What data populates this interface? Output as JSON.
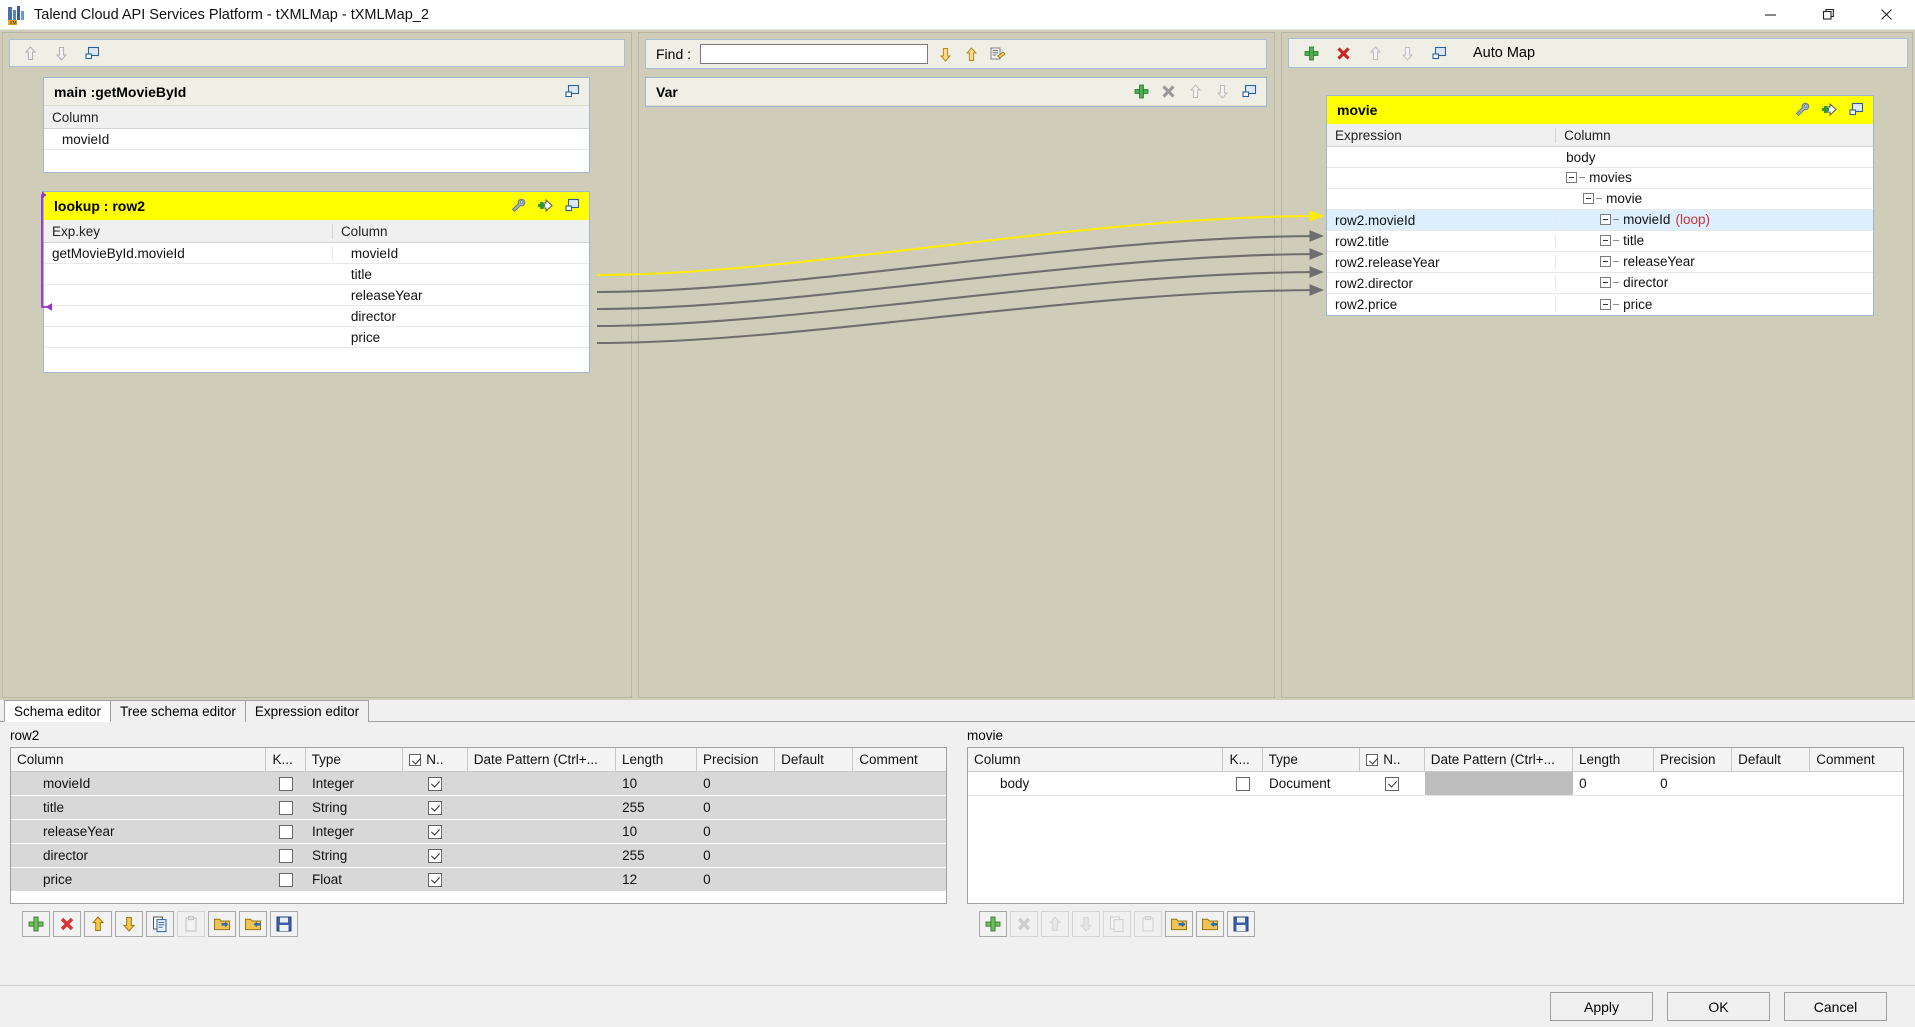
{
  "window": {
    "title": "Talend Cloud API Services Platform - tXMLMap - tXMLMap_2",
    "app_icon": "talend-icon",
    "minimize": "—",
    "maximize": "❐",
    "close": "✕"
  },
  "left_panel": {
    "toolbar_icons": [
      "arrow-up-icon",
      "arrow-down-icon",
      "minimize-table-icon"
    ],
    "main_table": {
      "title": "main :getMovieById",
      "header_icon": "minimize-table-icon",
      "columns": [
        "Column"
      ],
      "rows": [
        {
          "column": "movieId"
        },
        {
          "column": ""
        }
      ]
    },
    "lookup_table": {
      "title": "lookup : row2",
      "header_icons": [
        "wrench-icon",
        "add-filter-icon",
        "minimize-table-icon"
      ],
      "columns": [
        "Exp.key",
        "Column"
      ],
      "rows": [
        {
          "expkey": "getMovieById.movieId",
          "column": "movieId"
        },
        {
          "expkey": "",
          "column": "title"
        },
        {
          "expkey": "",
          "column": "releaseYear"
        },
        {
          "expkey": "",
          "column": "director"
        },
        {
          "expkey": "",
          "column": "price"
        }
      ]
    }
  },
  "middle_panel": {
    "find": {
      "label": "Find :",
      "value": "",
      "placeholder": ""
    },
    "find_icons": [
      "arrow-down-icon",
      "arrow-up-icon",
      "find-options-icon"
    ],
    "var_table": {
      "title": "Var",
      "header_icons": [
        "add-icon",
        "delete-icon",
        "arrow-up-icon",
        "arrow-down-icon",
        "minimize-table-icon"
      ],
      "rows": []
    }
  },
  "right_panel": {
    "toolbar_icons": [
      "add-icon",
      "delete-icon",
      "arrow-up-icon",
      "arrow-down-icon",
      "minimize-table-icon"
    ],
    "auto_map_label": "Auto Map",
    "output_table": {
      "title": "movie",
      "header_icons": [
        "wrench-icon",
        "add-filter-icon",
        "minimize-table-icon"
      ],
      "columns": [
        "Expression",
        "Column"
      ],
      "rows": [
        {
          "expression": "",
          "column": "body",
          "depth": 0,
          "expandable": false,
          "selected": false,
          "loop": ""
        },
        {
          "expression": "",
          "column": "movies",
          "depth": 1,
          "expandable": true,
          "selected": false,
          "loop": ""
        },
        {
          "expression": "",
          "column": "movie",
          "depth": 2,
          "expandable": true,
          "selected": false,
          "loop": ""
        },
        {
          "expression": "row2.movieId",
          "column": "movieId",
          "depth": 3,
          "expandable": true,
          "selected": true,
          "loop": "(loop)"
        },
        {
          "expression": "row2.title",
          "column": "title",
          "depth": 3,
          "expandable": true,
          "selected": false,
          "loop": ""
        },
        {
          "expression": "row2.releaseYear",
          "column": "releaseYear",
          "depth": 3,
          "expandable": true,
          "selected": false,
          "loop": ""
        },
        {
          "expression": "row2.director",
          "column": "director",
          "depth": 3,
          "expandable": true,
          "selected": false,
          "loop": ""
        },
        {
          "expression": "row2.price",
          "column": "price",
          "depth": 3,
          "expandable": true,
          "selected": false,
          "loop": ""
        }
      ]
    }
  },
  "bottom": {
    "tabs": [
      {
        "label": "Schema editor",
        "active": true
      },
      {
        "label": "Tree schema editor",
        "active": false
      },
      {
        "label": "Expression editor",
        "active": false
      }
    ],
    "left_editor": {
      "title": "row2",
      "headers": [
        "Column",
        "K...",
        "Type",
        "N..",
        "Date Pattern (Ctrl+...",
        "Length",
        "Precision",
        "Default",
        "Comment"
      ],
      "nullable_header_checked": true,
      "rows": [
        {
          "column": "movieId",
          "key": false,
          "type": "Integer",
          "nullable": true,
          "date_pattern": "",
          "length": "10",
          "precision": "0",
          "default": "",
          "comment": ""
        },
        {
          "column": "title",
          "key": false,
          "type": "String",
          "nullable": true,
          "date_pattern": "",
          "length": "255",
          "precision": "0",
          "default": "",
          "comment": ""
        },
        {
          "column": "releaseYear",
          "key": false,
          "type": "Integer",
          "nullable": true,
          "date_pattern": "",
          "length": "10",
          "precision": "0",
          "default": "",
          "comment": ""
        },
        {
          "column": "director",
          "key": false,
          "type": "String",
          "nullable": true,
          "date_pattern": "",
          "length": "255",
          "precision": "0",
          "default": "",
          "comment": ""
        },
        {
          "column": "price",
          "key": false,
          "type": "Float",
          "nullable": true,
          "date_pattern": "",
          "length": "12",
          "precision": "0",
          "default": "",
          "comment": ""
        }
      ],
      "toolbar": [
        {
          "icon": "add-icon",
          "enabled": true
        },
        {
          "icon": "delete-icon",
          "enabled": true
        },
        {
          "icon": "move-up-icon",
          "enabled": true
        },
        {
          "icon": "move-down-icon",
          "enabled": true
        },
        {
          "icon": "copy-icon",
          "enabled": true
        },
        {
          "icon": "paste-icon",
          "enabled": false
        },
        {
          "icon": "import-schema-icon",
          "enabled": true
        },
        {
          "icon": "export-schema-icon",
          "enabled": true
        },
        {
          "icon": "save-icon",
          "enabled": true
        }
      ]
    },
    "right_editor": {
      "title": "movie",
      "headers": [
        "Column",
        "K...",
        "Type",
        "N..",
        "Date Pattern (Ctrl+...",
        "Length",
        "Precision",
        "Default",
        "Comment"
      ],
      "nullable_header_checked": true,
      "rows": [
        {
          "column": "body",
          "key": false,
          "type": "Document",
          "nullable": true,
          "date_pattern": "",
          "length": "0",
          "precision": "0",
          "default": "",
          "comment": ""
        }
      ],
      "toolbar": [
        {
          "icon": "add-icon",
          "enabled": true
        },
        {
          "icon": "delete-icon",
          "enabled": false
        },
        {
          "icon": "move-up-icon",
          "enabled": false
        },
        {
          "icon": "move-down-icon",
          "enabled": false
        },
        {
          "icon": "copy-icon",
          "enabled": false
        },
        {
          "icon": "paste-icon",
          "enabled": false
        },
        {
          "icon": "import-schema-icon",
          "enabled": true
        },
        {
          "icon": "export-schema-icon",
          "enabled": true
        },
        {
          "icon": "save-icon",
          "enabled": true
        }
      ]
    }
  },
  "footer": {
    "apply": "Apply",
    "ok": "OK",
    "cancel": "Cancel"
  },
  "colors": {
    "highlight_yellow": "#ffff00",
    "selection_blue": "#ddeeff",
    "canvas": "#cfcdba",
    "wire_gray": "#6e6e6e",
    "wire_yellow": "#ffec00",
    "loop_red": "#d03030",
    "lookup_link_purple": "#9b30c8"
  }
}
